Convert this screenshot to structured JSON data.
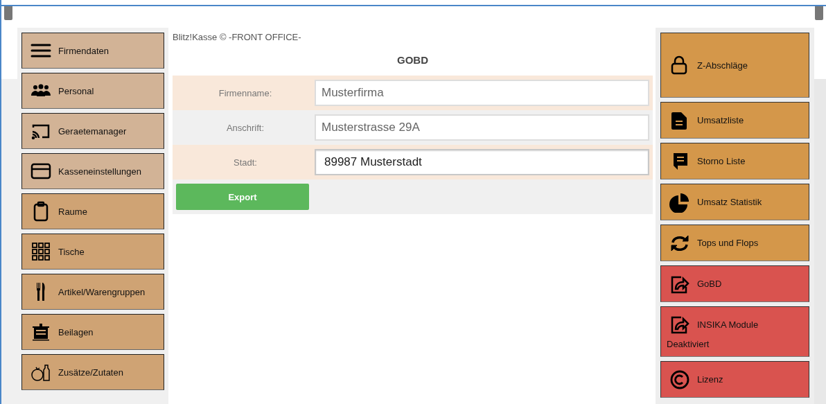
{
  "left_menu": [
    {
      "label": "Firmendaten",
      "color": "#d2b396"
    },
    {
      "label": "Personal",
      "color": "#d2b396"
    },
    {
      "label": "Geraetemanager",
      "color": "#d2b396"
    },
    {
      "label": "Kasseneinstellungen",
      "color": "#d2b396"
    },
    {
      "label": "Raume",
      "color": "#cfa374"
    },
    {
      "label": "Tische",
      "color": "#cfa374"
    },
    {
      "label": "Artikel/Warengruppen",
      "color": "#cfa374"
    },
    {
      "label": "Beilagen",
      "color": "#cfa374"
    },
    {
      "label": "Zusätze/Zutaten",
      "color": "#cfa374"
    }
  ],
  "header": {
    "app_name": "Blitz!Kasse © -FRONT OFFICE-",
    "title": "GOBD"
  },
  "form": [
    {
      "label": "Firmenname:",
      "value": "Musterfirma",
      "focused": false
    },
    {
      "label": "Anschrift:",
      "value": "Musterstrasse 29A",
      "focused": false
    },
    {
      "label": "Stadt:",
      "value": "89987 Musterstadt",
      "focused": true
    }
  ],
  "export_button": "Export",
  "right_menu": [
    {
      "label": "Z-Abschläge",
      "color": "#d4974a",
      "tall": true
    },
    {
      "label": "Umsatzliste",
      "color": "#d4974a",
      "tall": false
    },
    {
      "label": "Storno Liste",
      "color": "#d4974a",
      "tall": false
    },
    {
      "label": "Umsatz Statistik",
      "color": "#d4974a",
      "tall": false
    },
    {
      "label": "Tops und Flops",
      "color": "#d4974a",
      "tall": false
    },
    {
      "label": "GoBD",
      "color": "#d9534f",
      "tall": false
    },
    {
      "label": "INSIKA Module",
      "sublabel": "Deaktiviert",
      "color": "#d9534f",
      "tall": false
    },
    {
      "label": "Lizenz",
      "color": "#d9534f",
      "tall": false
    }
  ]
}
